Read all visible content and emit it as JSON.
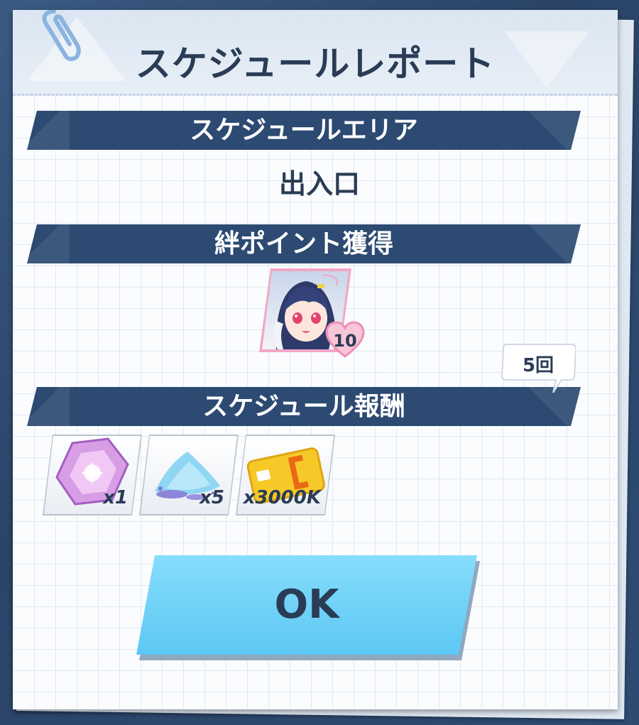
{
  "dialog": {
    "title": "スケジュールレポート"
  },
  "sections": {
    "area_header": "スケジュールエリア",
    "area_value": "出入口",
    "bond_header": "絆ポイント獲得",
    "bond_points": "10",
    "reward_header": "スケジュール報酬",
    "reward_count": "5回"
  },
  "rewards": [
    {
      "icon": "purple-crystal-icon",
      "qty": "x1"
    },
    {
      "icon": "blue-powder-icon",
      "qty": "x5"
    },
    {
      "icon": "credit-card-icon",
      "qty": "x3000K"
    }
  ],
  "buttons": {
    "ok_label": "OK"
  },
  "colors": {
    "header_bar": "#2c4a72",
    "ok_button": "#6fd0f8",
    "heart": "#f5a9c8",
    "card_gold": "#f7c928"
  }
}
